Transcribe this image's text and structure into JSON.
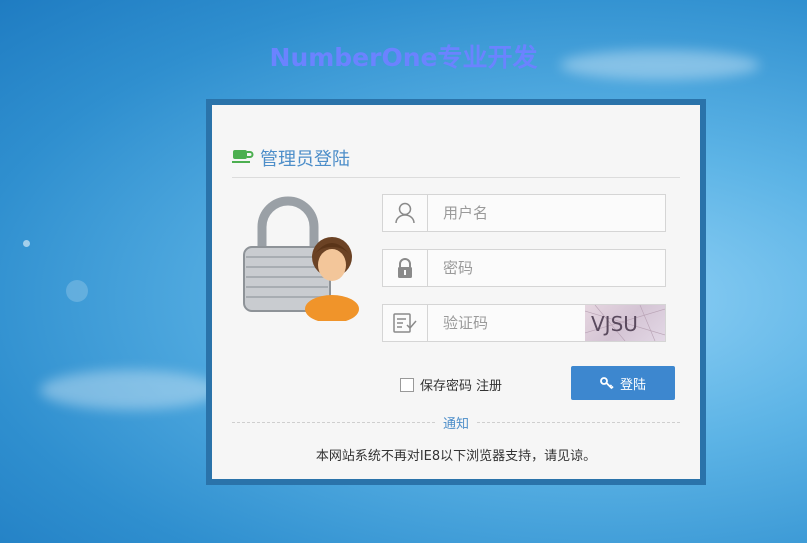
{
  "page": {
    "title": "NumberOne专业开发"
  },
  "login": {
    "heading": "管理员登陆",
    "username_placeholder": "用户名",
    "password_placeholder": "密码",
    "captcha_placeholder": "验证码",
    "captcha_text": "VJSU",
    "remember_label": "保存密码",
    "register_label": "注册",
    "login_button": "登陆"
  },
  "notice": {
    "label": "通知",
    "text": "本网站系统不再对IE8以下浏览器支持，请见谅。"
  },
  "icons": {
    "heading": "cup-icon",
    "username": "user-icon",
    "password": "lock-icon",
    "captcha": "captcha-icon",
    "login": "key-icon"
  },
  "colors": {
    "accent": "#3d87cf",
    "title": "#6b83ff",
    "card_border": "#2a73aa"
  }
}
